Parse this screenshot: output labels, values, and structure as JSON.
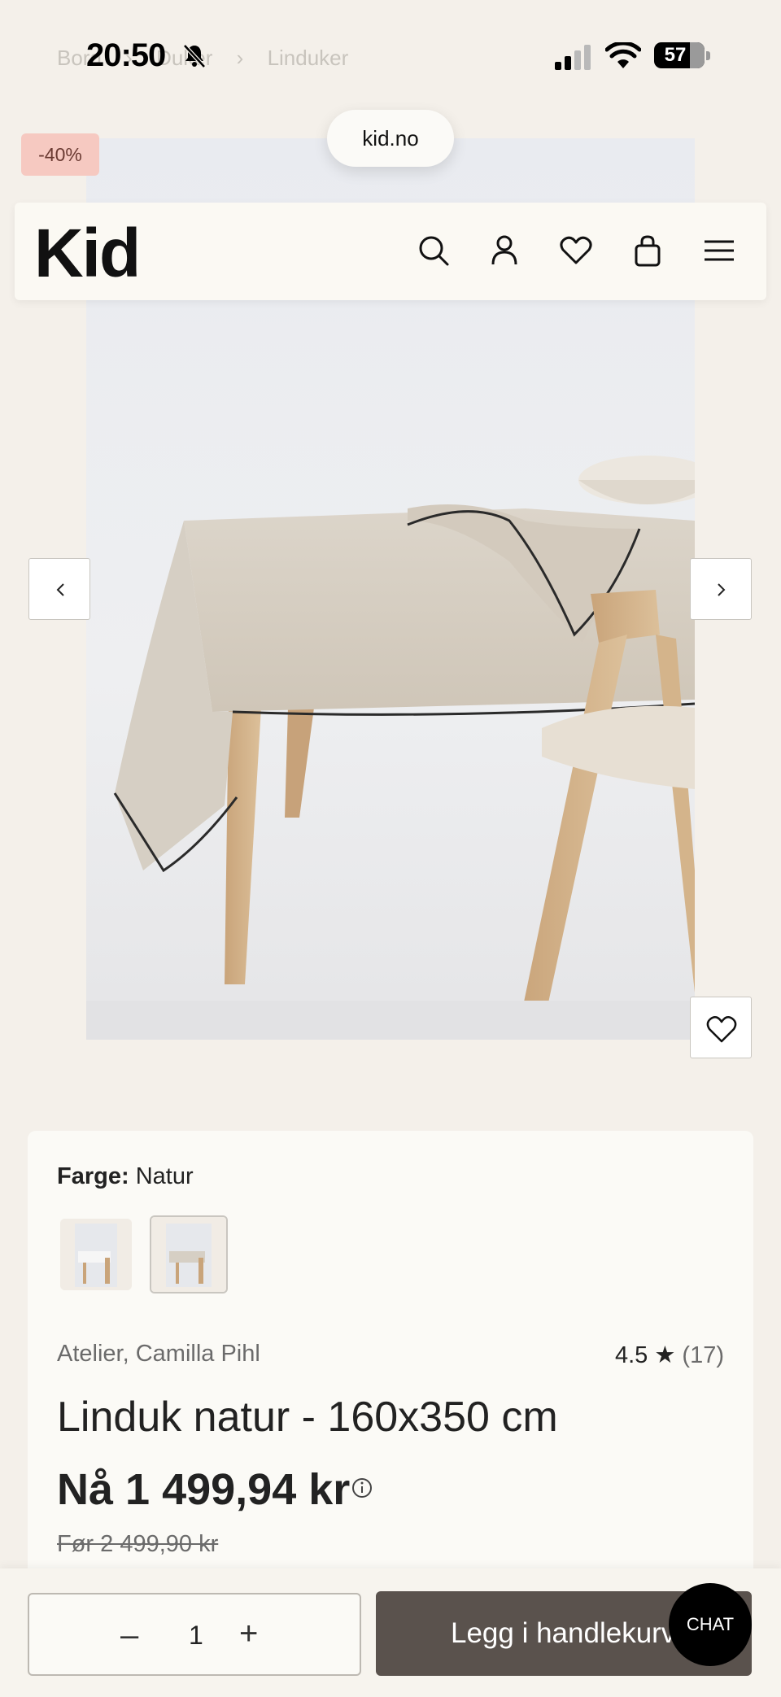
{
  "status_bar": {
    "time": "20:50",
    "battery": "57",
    "icons": [
      "bell-slash-icon",
      "cell-signal-icon",
      "wifi-icon",
      "battery-icon"
    ]
  },
  "breadcrumbs": [
    "Bord",
    "Duker",
    "Linduker"
  ],
  "browser": {
    "url": "kid.no"
  },
  "header": {
    "logo": "Kid",
    "icons": [
      "search-icon",
      "account-icon",
      "heart-icon",
      "bag-icon",
      "menu-icon"
    ]
  },
  "product": {
    "discount_badge": "-40%",
    "color_label": "Farge:",
    "color_value": "Natur",
    "brand": "Atelier, Camilla Pihl",
    "rating": "4.5",
    "rating_count": "(17)",
    "title": "Linduk natur - 160x350 cm",
    "price_prefix": "Nå",
    "price": "1 499,94 kr",
    "before_price": "Før 2 499,90 kr"
  },
  "cart": {
    "quantity": "1",
    "minus_symbol": "–",
    "plus_symbol": "+",
    "add_label": "Legg i handlekurv",
    "chat_label": "CHAT"
  },
  "colors": {
    "background": "#f4f0ea",
    "card": "#fbfaf6",
    "badge": "#f6c9c1",
    "cart_button": "#5a524d",
    "chat_button": "#000000"
  }
}
